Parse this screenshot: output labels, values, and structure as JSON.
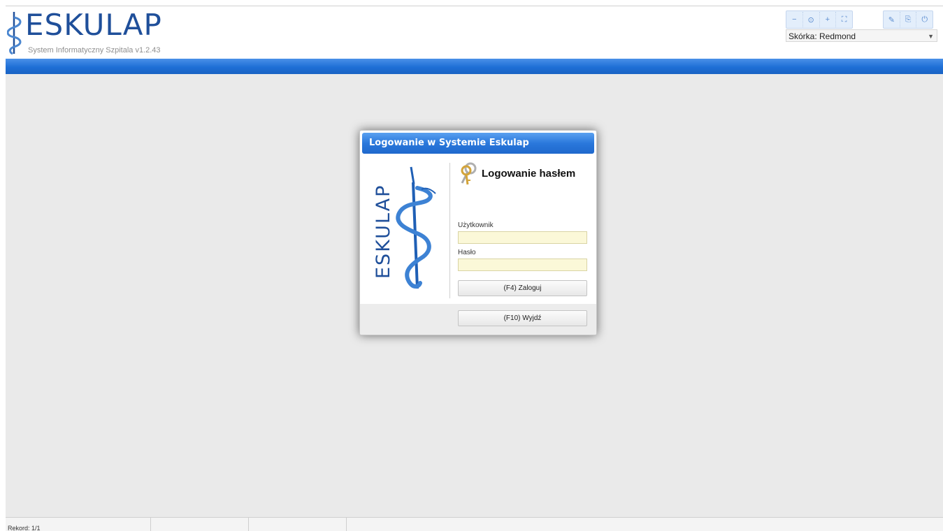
{
  "header": {
    "title": "ESKULAP",
    "subtitle": "System Informatyczny Szpitala v1.2.43"
  },
  "toolbar": {
    "zoom_buttons": [
      {
        "label": "−",
        "icon": "zoom-out-icon"
      },
      {
        "label": "⊙",
        "icon": "zoom-reset-icon"
      },
      {
        "label": "+",
        "icon": "zoom-in-icon"
      },
      {
        "label": "⛶",
        "icon": "fullscreen-icon"
      }
    ],
    "tool_buttons": [
      {
        "label": "✎",
        "icon": "wrench-icon"
      },
      {
        "label": "⎘",
        "icon": "restore-icon"
      },
      {
        "label": "⏻",
        "icon": "power-icon"
      }
    ],
    "skin_select": "Skórka: Redmond",
    "skin_arrow": "▼"
  },
  "dialog": {
    "title": "Logowanie w Systemie Eskulap",
    "brand_text": "ESKULAP",
    "form_title": "Logowanie hasłem",
    "user_label": "Użytkownik",
    "user_value": "",
    "password_label": "Hasło",
    "password_value": "",
    "login_button": "(F4) Zaloguj",
    "exit_button": "(F10) Wyjdź"
  },
  "statusbar": {
    "cells": [
      "Rekord: 1/1",
      "",
      "",
      ""
    ]
  },
  "colors": {
    "accent_blue": "#1e6fd6",
    "input_bg": "#fbf8d8",
    "workspace_bg": "#eaeaea"
  }
}
